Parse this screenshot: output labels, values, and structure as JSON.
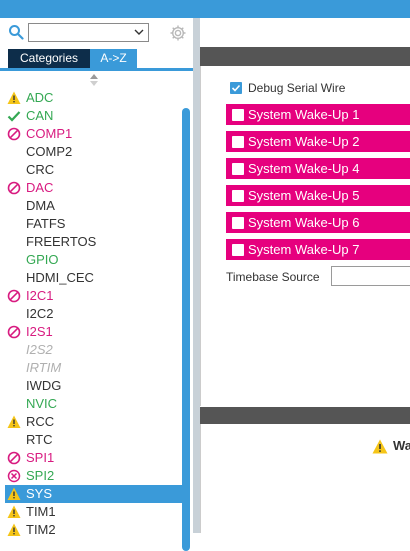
{
  "left_panel": {
    "search": {
      "value": "",
      "placeholder": ""
    },
    "tabs": [
      {
        "label": "Categories"
      },
      {
        "label": "A->Z"
      }
    ],
    "items": [
      {
        "label": "ADC",
        "status": "warning",
        "color": "green"
      },
      {
        "label": "CAN",
        "status": "check",
        "color": "green"
      },
      {
        "label": "COMP1",
        "status": "blocked",
        "color": "pink"
      },
      {
        "label": "COMP2",
        "status": "none",
        "color": "dark"
      },
      {
        "label": "CRC",
        "status": "none",
        "color": "dark"
      },
      {
        "label": "DAC",
        "status": "blocked",
        "color": "pink"
      },
      {
        "label": "DMA",
        "status": "none",
        "color": "dark"
      },
      {
        "label": "FATFS",
        "status": "none",
        "color": "dark"
      },
      {
        "label": "FREERTOS",
        "status": "none",
        "color": "dark"
      },
      {
        "label": "GPIO",
        "status": "none",
        "color": "green"
      },
      {
        "label": "HDMI_CEC",
        "status": "none",
        "color": "dark"
      },
      {
        "label": "I2C1",
        "status": "blocked",
        "color": "pink"
      },
      {
        "label": "I2C2",
        "status": "none",
        "color": "dark"
      },
      {
        "label": "I2S1",
        "status": "blocked",
        "color": "pink"
      },
      {
        "label": "I2S2",
        "status": "none",
        "color": "gray"
      },
      {
        "label": "IRTIM",
        "status": "none",
        "color": "gray"
      },
      {
        "label": "IWDG",
        "status": "none",
        "color": "dark"
      },
      {
        "label": "NVIC",
        "status": "none",
        "color": "green"
      },
      {
        "label": "RCC",
        "status": "warning",
        "color": "dark"
      },
      {
        "label": "RTC",
        "status": "none",
        "color": "dark"
      },
      {
        "label": "SPI1",
        "status": "blocked",
        "color": "pink"
      },
      {
        "label": "SPI2",
        "status": "partial",
        "color": "green"
      },
      {
        "label": "SYS",
        "status": "warning",
        "color": "selected",
        "selected": true
      },
      {
        "label": "TIM1",
        "status": "warning",
        "color": "dark"
      },
      {
        "label": "TIM2",
        "status": "warning",
        "color": "dark"
      }
    ]
  },
  "right_panel": {
    "debug_serial_wire": {
      "label": "Debug Serial Wire",
      "checked": true
    },
    "wakeups": [
      {
        "label": "System Wake-Up 1",
        "checked": false
      },
      {
        "label": "System Wake-Up 2",
        "checked": false
      },
      {
        "label": "System Wake-Up 4",
        "checked": false
      },
      {
        "label": "System Wake-Up 5",
        "checked": false
      },
      {
        "label": "System Wake-Up 6",
        "checked": false
      },
      {
        "label": "System Wake-Up 7",
        "checked": false
      }
    ],
    "timebase": {
      "label": "Timebase Source",
      "value": ""
    },
    "warning_label": "Wa"
  },
  "colors": {
    "accent": "#3a9ad9",
    "dark_tab": "#0d2d4a",
    "wakeup_bg": "#e6007e",
    "green": "#34a853",
    "pink": "#d81b80",
    "warning": "#f5c518",
    "header_bar": "#555555"
  }
}
